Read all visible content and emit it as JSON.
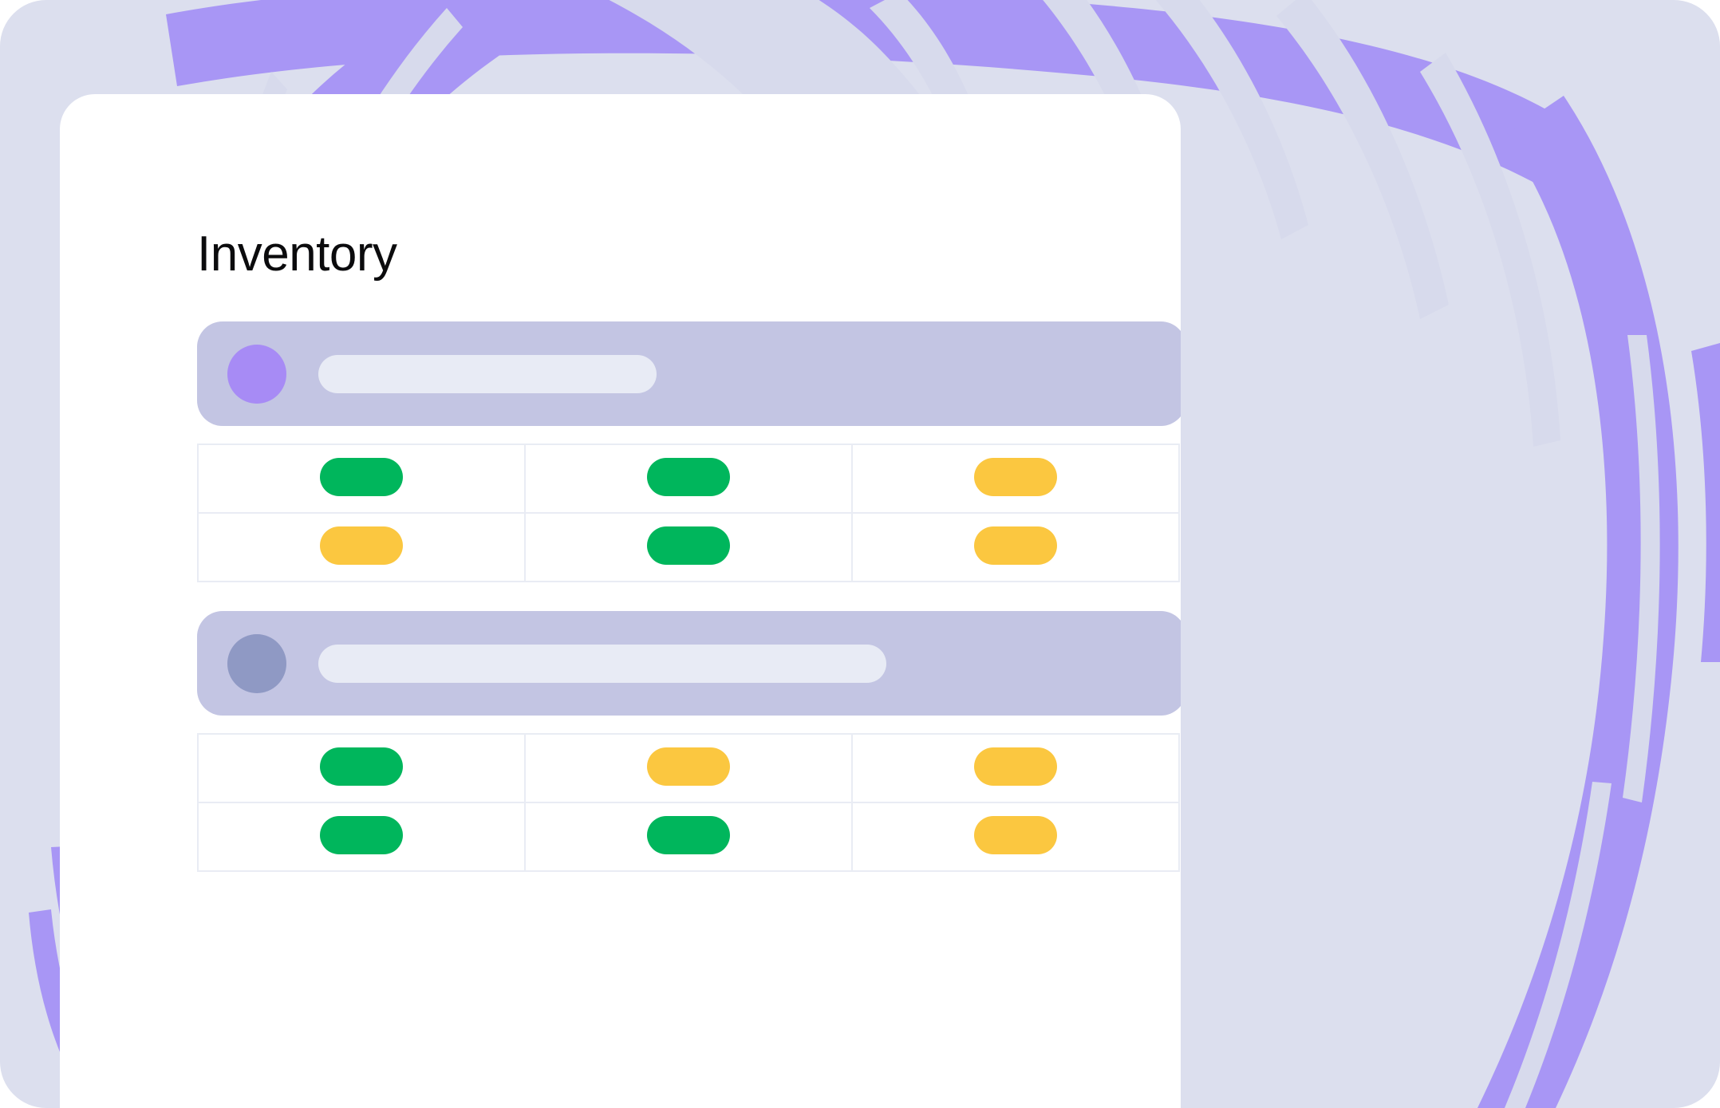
{
  "app": {
    "title": "Inventory",
    "card_background": "#ffffff",
    "canvas_background": "#dcdfee",
    "brush_color": "#a896f5",
    "brush_highlight_color": "#d7daec"
  },
  "palette": {
    "header_bar": "#c3c5e3",
    "placeholder_pill": "#e8ebf5",
    "avatar_purple": "#a78bf5",
    "avatar_slate": "#8f99c4",
    "status_green": "#00b65c",
    "status_yellow": "#fbc740",
    "table_border": "#e9ecf4",
    "title_color": "#0b0b0d"
  },
  "sections": [
    {
      "id": "section-1",
      "header": {
        "avatar_color": "avatar_purple",
        "placeholder_width": "short"
      },
      "table": {
        "columns": 3,
        "rows": [
          {
            "cells": [
              "green",
              "green",
              "yellow"
            ]
          },
          {
            "cells": [
              "yellow",
              "green",
              "yellow"
            ]
          }
        ]
      }
    },
    {
      "id": "section-2",
      "header": {
        "avatar_color": "avatar_slate",
        "placeholder_width": "long"
      },
      "table": {
        "columns": 3,
        "rows": [
          {
            "cells": [
              "green",
              "yellow",
              "yellow"
            ]
          },
          {
            "cells": [
              "green",
              "green",
              "yellow"
            ]
          }
        ]
      }
    }
  ]
}
